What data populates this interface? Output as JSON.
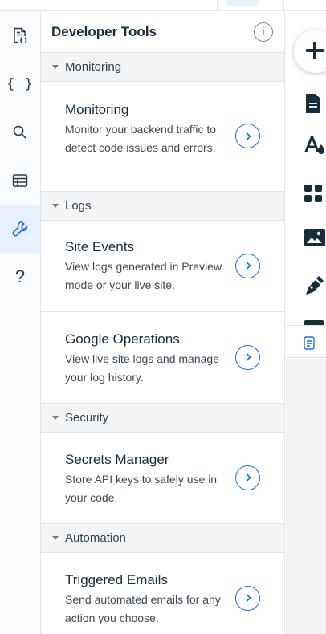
{
  "top_bar": {},
  "rail": {
    "items": [
      {
        "name": "page-code-icon"
      },
      {
        "name": "code-braces-icon",
        "glyph": "{ }"
      },
      {
        "name": "search-icon"
      },
      {
        "name": "database-table-icon"
      },
      {
        "name": "wrench-icon",
        "active": true
      },
      {
        "name": "help-icon",
        "glyph": "?"
      }
    ]
  },
  "panel": {
    "title": "Developer Tools",
    "info_glyph": "i",
    "sections": [
      {
        "label": "Monitoring",
        "items": [
          {
            "title": "Monitoring",
            "description": "Monitor your backend traffic to detect code issues and errors."
          }
        ]
      },
      {
        "label": "Logs",
        "items": [
          {
            "title": "Site Events",
            "description": "View logs generated in Preview mode or your live site."
          },
          {
            "title": "Google Operations",
            "description": "View live site logs and manage your log history."
          }
        ]
      },
      {
        "label": "Security",
        "items": [
          {
            "title": "Secrets Manager",
            "description": "Store API keys to safely use in your code."
          }
        ]
      },
      {
        "label": "Automation",
        "items": [
          {
            "title": "Triggered Emails",
            "description": "Send automated emails for any action you choose."
          }
        ]
      }
    ]
  },
  "right_toolbar": {
    "items": [
      "add-icon",
      "page-icon",
      "text-theme-icon",
      "apps-grid-icon",
      "media-image-icon",
      "pen-icon",
      "page-outline-icon"
    ],
    "accent": "#116dff"
  }
}
